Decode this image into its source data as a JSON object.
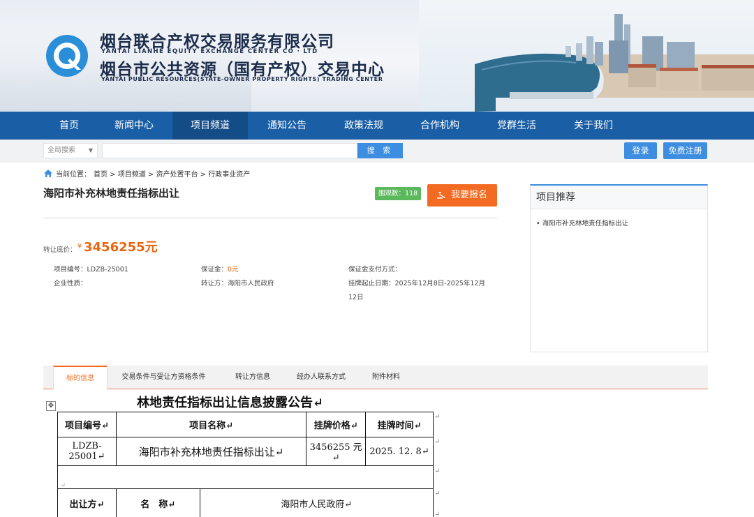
{
  "header": {
    "brand_cn_1": "烟台联合产权交易服务有限公司",
    "brand_en_1": "YANTAI LIANHE EQUITY EXCHANGE CENTER CO · LTD",
    "brand_cn_2": "烟台市公共资源（国有产权）交易中心",
    "brand_en_2": "YANTAI PUBLIC RESOURCES(STATE-OWNER PROPERTY RIGHTS) TRADING CENTER",
    "logo_icon": "q-logo-icon"
  },
  "nav": {
    "items": [
      "首页",
      "新闻中心",
      "项目频道",
      "通知公告",
      "政策法规",
      "合作机构",
      "党群生活",
      "关于我们"
    ],
    "active": "项目频道"
  },
  "search": {
    "scope": "全局搜索",
    "value": "",
    "button": "搜 索",
    "login": "登录",
    "register": "免费注册"
  },
  "breadcrumb": {
    "prefix": "当前位置：",
    "path": "首页 > 项目频道 > 资产处置平台 > 行政事业资产"
  },
  "project": {
    "title": "海阳市补充林地责任指标出让",
    "views": "围观数：118",
    "apply": "我要报名",
    "price_label": "转让底价：",
    "price_currency": "¥",
    "price_value": "3456255元",
    "code": "项目编号：LDZB-25001",
    "company_type": "企业性质：",
    "deposit_label": "保证金：",
    "deposit_value": "0元",
    "transferor": "转让方：海阳市人民政府",
    "deposit_method": "保证金支付方式：",
    "listing_period_1": "挂牌起止日期：2025年12月8日-2025年12月",
    "listing_period_2": "12日"
  },
  "recommend": {
    "title": "项目推荐",
    "items": [
      "• 海阳市补充林地责任指标出让"
    ]
  },
  "tabs": [
    "标的信息",
    "交易条件与受让方资格条件",
    "转让方信息",
    "经办人联系方式",
    "附件材料"
  ],
  "document": {
    "title": "林地责任指标出让信息披露公告↵",
    "headers": [
      "项目编号↵",
      "项目名称↵",
      "挂牌价格↵",
      "挂牌时间↵"
    ],
    "row": [
      "LDZB-25001↵",
      "海阳市补充林地责任指标出让↵",
      "3456255 元↵",
      "2025. 12. 8↵"
    ],
    "seller_label": "出让方↵",
    "name_label": "名　称↵",
    "seller_name": "海阳市人民政府↵",
    "para_mark": "↵"
  }
}
